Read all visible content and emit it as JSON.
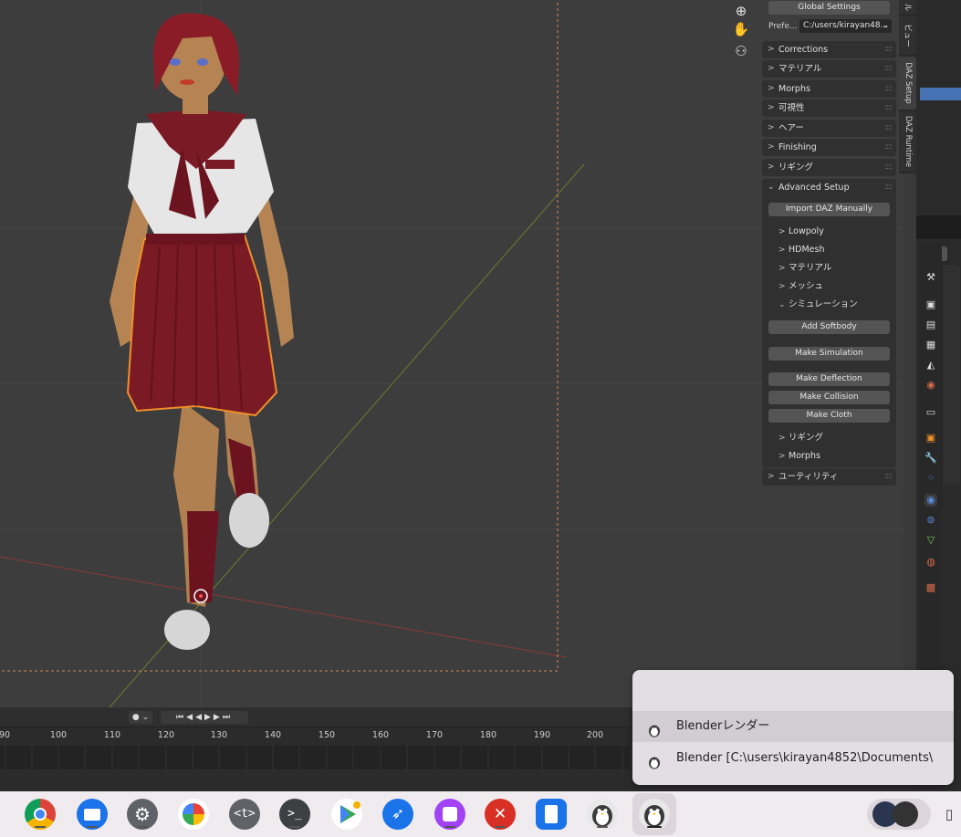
{
  "viewport": {
    "nav_icons": [
      "zoom-icon",
      "hand-icon",
      "camera-icon"
    ]
  },
  "npanel": {
    "global_settings": "Global Settings",
    "pref_label": "Prefe...",
    "pref_value": "C:/users/kirayan48...",
    "sections": [
      "Corrections",
      "マテリアル",
      "Morphs",
      "可視性",
      "ヘアー",
      "Finishing",
      "リギング"
    ],
    "advanced_setup": "Advanced Setup",
    "import_daz": "Import DAZ Manually",
    "sub_items": [
      "Lowpoly",
      "HDMesh",
      "マテリアル",
      "メッシュ"
    ],
    "simulation": "シミュレーション",
    "add_softbody": "Add Softbody",
    "make_simulation": "Make Simulation",
    "make_deflection": "Make Deflection",
    "make_collision": "Make Collision",
    "make_cloth": "Make Cloth",
    "sub_items2": [
      "リギング",
      "Morphs"
    ],
    "utility": "ユーティリティ"
  },
  "vtabs": [
    "ル",
    "ビュー",
    "DAZ Setup",
    "DAZ Runtime"
  ],
  "timeline": {
    "frame_numbers": [
      "90",
      "100",
      "110",
      "120",
      "130",
      "140",
      "150",
      "160",
      "170",
      "180",
      "190",
      "200"
    ]
  },
  "popup": {
    "items": [
      "Blenderレンダー",
      "Blender [C:\\users\\kirayan4852\\Documents\\"
    ]
  },
  "shelf": {
    "apps": [
      "chrome-icon",
      "files-icon",
      "settings-icon",
      "photos-icon",
      "text-editor-icon",
      "terminal-icon",
      "play-store-icon",
      "rocket-icon",
      "gallery-icon",
      "remote-desktop-icon",
      "clipboard-app-icon",
      "linux-penguin-icon",
      "linux-penguin-active-icon"
    ]
  },
  "colors": {
    "accent_blue": "#4772b3",
    "selection_orange": "#f0902a",
    "viewport_bg": "#3d3d3d",
    "skirt": "#7a1a24"
  }
}
